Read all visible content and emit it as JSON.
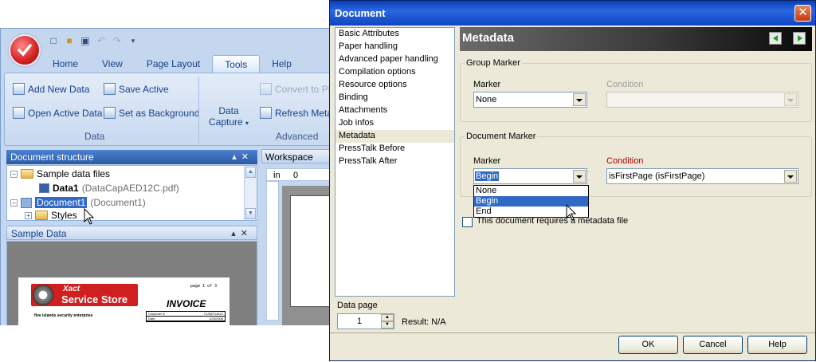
{
  "app": {
    "ribbon_tabs": [
      "Home",
      "View",
      "Page Layout",
      "Tools",
      "Help"
    ],
    "active_tab": "Tools",
    "data_group": {
      "add_new_data": "Add New Data",
      "save_active": "Save Active",
      "open_active_data": "Open Active Data",
      "set_as_background": "Set as Background",
      "label": "Data"
    },
    "advanced_group": {
      "data_capture_line1": "Data",
      "data_capture_line2": "Capture",
      "convert_to_pl": "Convert to Pla",
      "refresh_meta": "Refresh Meta",
      "label": "Advanced"
    },
    "document_structure": {
      "title": "Document structure",
      "items": [
        {
          "label": "Sample data files",
          "extra": ""
        },
        {
          "label": "Data1",
          "extra": "(DataCapAED12C.pdf)"
        },
        {
          "label": "Document1",
          "extra": "(Document1)"
        },
        {
          "label": "Styles",
          "extra": ""
        }
      ]
    },
    "sample_data": {
      "title": "Sample Data",
      "logo_line1": "Xact",
      "logo_line2": "Service Store",
      "invoice_title": "INVOICE",
      "page_text": "page 1 of 3",
      "company": "five islands security enterprise",
      "table": [
        [
          "Customer #",
          "CUS8714412"
        ],
        [
          "Date",
          "1/24/2008"
        ]
      ]
    },
    "workspace": {
      "title": "Workspace",
      "ruler_unit": "in",
      "ruler_zero": "0"
    }
  },
  "dialog": {
    "title": "Document",
    "nav_items": [
      "Basic Attributes",
      "Paper handling",
      "Advanced paper handling",
      "Compilation options",
      "Resource options",
      "Binding",
      "Attachments",
      "Job infos",
      "Metadata",
      "PressTalk Before",
      "PressTalk After"
    ],
    "selected_nav": "Metadata",
    "data_page_label": "Data page",
    "data_page_value": "1",
    "result_text": "Result: N/A",
    "header": "Metadata",
    "group_marker": {
      "legend": "Group Marker",
      "marker_label": "Marker",
      "marker_value": "None",
      "condition_label": "Condition",
      "condition_value": ""
    },
    "document_marker": {
      "legend": "Document Marker",
      "marker_label": "Marker",
      "marker_value": "Begin",
      "condition_label": "Condition",
      "condition_value": "isFirstPage (isFirstPage)"
    },
    "marker_options": [
      "None",
      "Begin",
      "End"
    ],
    "marker_selected_option": "Begin",
    "requires_metadata_label": "This document requires a metadata file",
    "requires_metadata_checked": false,
    "buttons": {
      "ok": "OK",
      "cancel": "Cancel",
      "help": "Help"
    }
  },
  "colors": {
    "title_bar": "#0a3db8",
    "selection": "#316ac5",
    "condition_label": "#b40000",
    "ribbon_text": "#15428b"
  }
}
